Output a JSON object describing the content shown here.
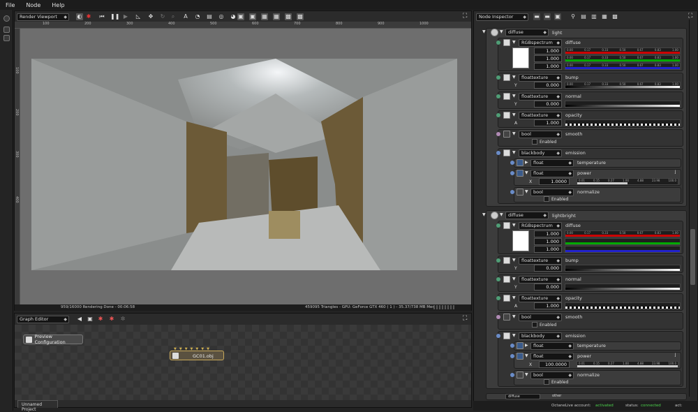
{
  "menu": {
    "file": "File",
    "node": "Node",
    "help": "Help"
  },
  "viewport": {
    "title": "Render Viewport",
    "ruler": [
      "100",
      "200",
      "300",
      "400",
      "500",
      "600",
      "700",
      "800",
      "900",
      "1000"
    ],
    "vruler": [
      "100",
      "200",
      "300",
      "400"
    ],
    "status_left": "959/16000 Rendering Done - 00:06:58",
    "status_right": "459095 Triangles - GPU: GeForce GTX 460 ( 1 ) - 35.37/738 MB Mem Used"
  },
  "graph_editor": {
    "title": "Graph Editor",
    "preview_button": "Preview Configuration",
    "node_label": "GC01.obj",
    "tab": "Unnamed Project"
  },
  "inspector": {
    "title": "Node Inspector",
    "groups": [
      {
        "type": "diffuse",
        "name": "light",
        "diffuse": {
          "type": "RGBspectrum",
          "label": "diffuse",
          "values": [
            "1.000",
            "1.000",
            "1.000"
          ],
          "scale": [
            "0.00",
            "0.17",
            "0.33",
            "0.50",
            "0.67",
            "0.83",
            "1.00"
          ]
        },
        "bump": {
          "type": "floattexture",
          "label": "bump",
          "axis": "Y",
          "value": "0.000"
        },
        "normal": {
          "type": "floattexture",
          "label": "normal",
          "axis": "Y",
          "value": "0.000"
        },
        "opacity": {
          "type": "floattexture",
          "label": "opacity",
          "axis": "A",
          "value": "1.000"
        },
        "smooth": {
          "type": "bool",
          "label": "smooth",
          "check": "Enabled"
        },
        "emission": {
          "type": "blackbody",
          "label": "emission",
          "temperature": {
            "type": "float",
            "label": "temperature"
          },
          "power": {
            "type": "float",
            "label": "power",
            "axis": "X",
            "value": "1.0000",
            "scale": [
              "0.01",
              "0.15",
              "0.27",
              "1.00",
              "4.88",
              "23.98",
              "100.0"
            ]
          },
          "normalize": {
            "type": "bool",
            "label": "normalize",
            "check": "Enabled"
          }
        }
      },
      {
        "type": "diffuse",
        "name": "lightbright",
        "diffuse": {
          "type": "RGBspectrum",
          "label": "diffuse",
          "values": [
            "1.000",
            "1.000",
            "1.000"
          ],
          "scale": [
            "0.00",
            "0.17",
            "0.33",
            "0.50",
            "0.67",
            "0.83",
            "1.00"
          ]
        },
        "bump": {
          "type": "floattexture",
          "label": "bump",
          "axis": "Y",
          "value": "0.000"
        },
        "normal": {
          "type": "floattexture",
          "label": "normal",
          "axis": "Y",
          "value": "0.000"
        },
        "opacity": {
          "type": "floattexture",
          "label": "opacity",
          "axis": "A",
          "value": "1.000"
        },
        "smooth": {
          "type": "bool",
          "label": "smooth",
          "check": "Enabled"
        },
        "emission": {
          "type": "blackbody",
          "label": "emission",
          "temperature": {
            "type": "float",
            "label": "temperature"
          },
          "power": {
            "type": "float",
            "label": "power",
            "axis": "X",
            "value": "100.0000",
            "scale": [
              "0.01",
              "0.15",
              "0.27",
              "1.00",
              "4.88",
              "23.98",
              "100.0"
            ]
          },
          "normalize": {
            "type": "bool",
            "label": "normalize",
            "check": "Enabled"
          }
        }
      }
    ],
    "bottom_type": "diffuse",
    "bottom_name": "other"
  },
  "status": {
    "account_label": "OctaneLive account:",
    "account_value": "activated",
    "status_label": "status:",
    "status_value": "connected",
    "act": "act:"
  }
}
